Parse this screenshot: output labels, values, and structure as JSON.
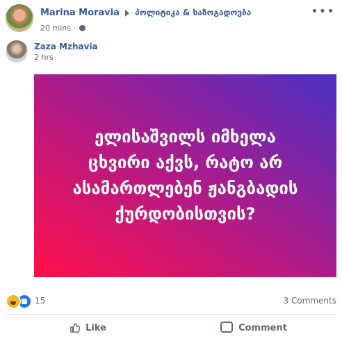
{
  "post": {
    "author": "Marina Moravia",
    "group": "პოლიტიკა & საზოგადოება",
    "time": "20 mins",
    "more": "•••"
  },
  "shared": {
    "author": "Zaza Mzhavia",
    "time": "2 hrs"
  },
  "image": {
    "text": "ელისაშვილს იმხელა\nცხვირი აქვს, რატო არ\nასამართლებენ ჟანგბადის\nქურდობისთვის?",
    "gradient": {
      "from": "#ff1048",
      "mid": "#b61a84",
      "to": "#4b30c4"
    }
  },
  "reactions": {
    "count": "15",
    "comments": "3 Comments",
    "icons": [
      "haha-icon",
      "like-icon"
    ]
  },
  "actions": {
    "like": "Like",
    "comment": "Comment"
  },
  "colors": {
    "link": "#385898",
    "secondary": "#606770",
    "like_blue": "#1877f2"
  }
}
